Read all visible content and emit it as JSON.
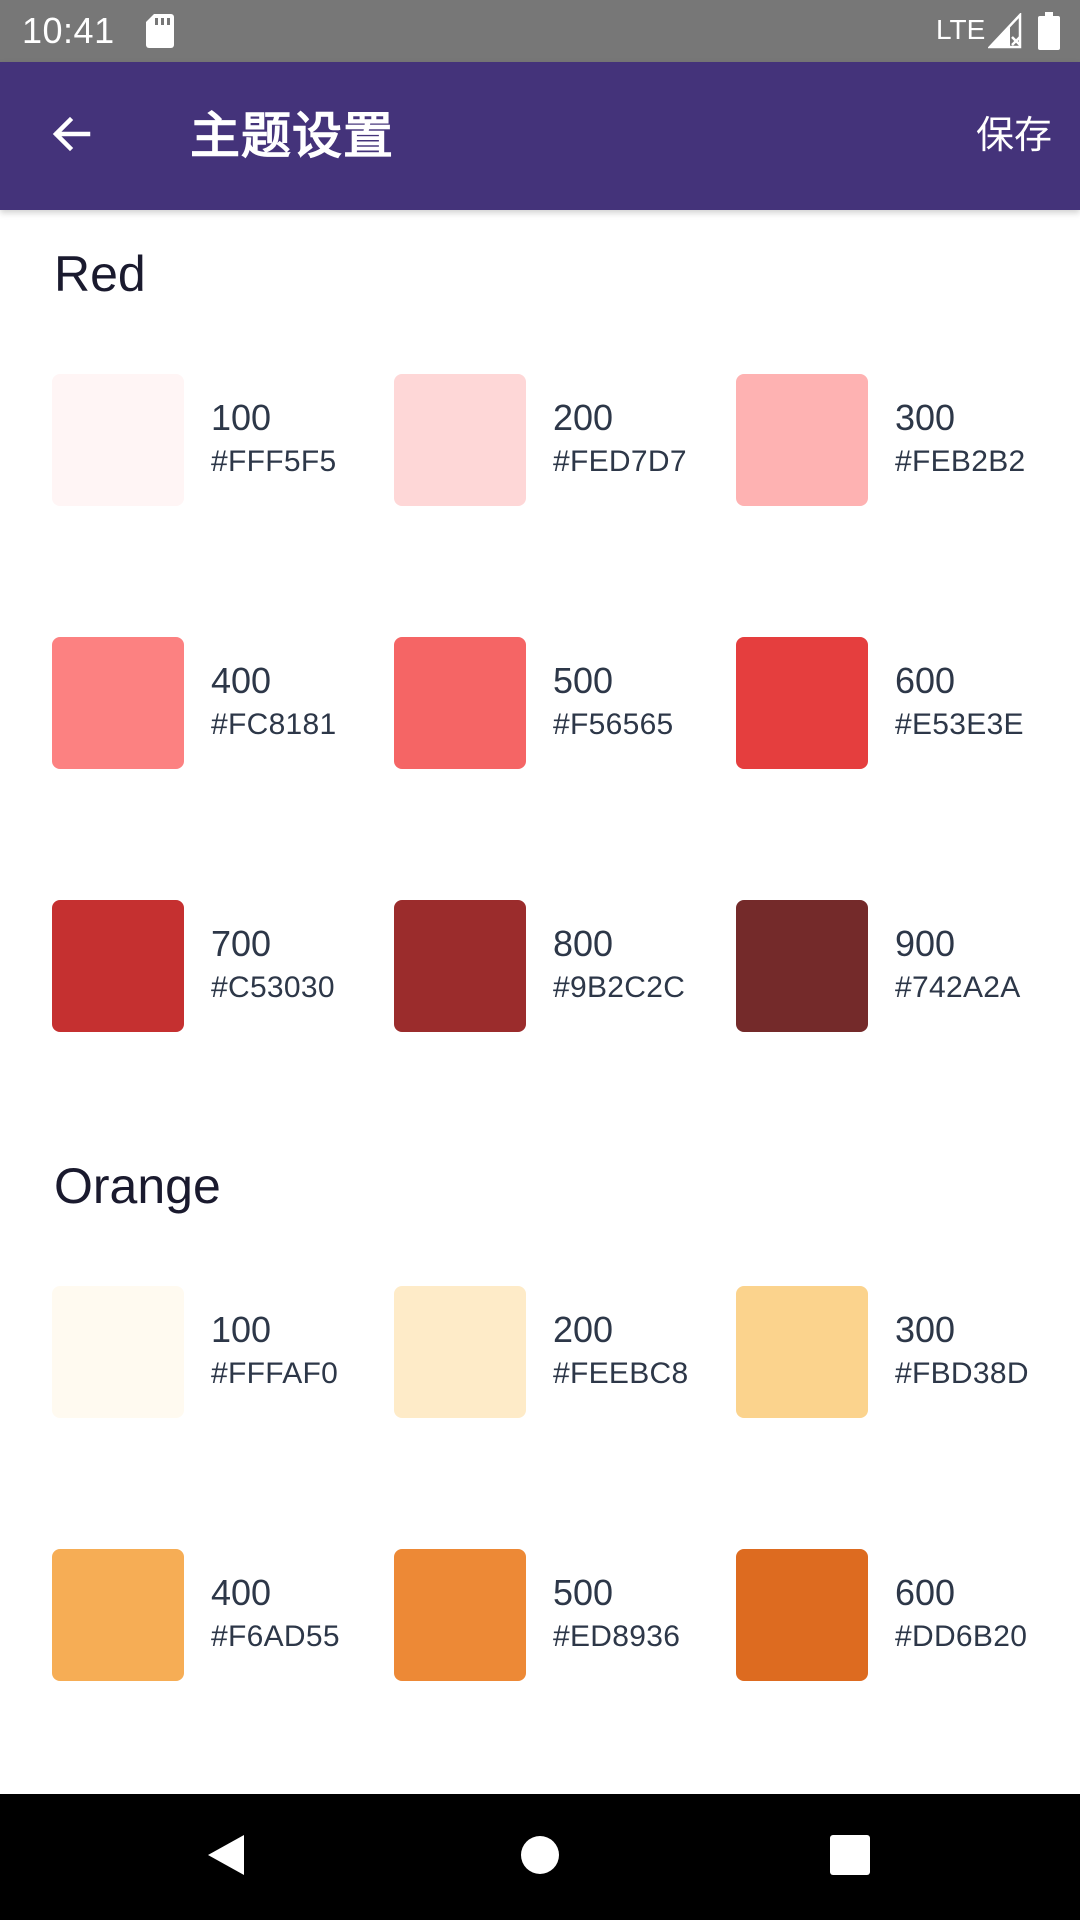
{
  "status_bar": {
    "time": "10:41",
    "network": "LTE",
    "icons": [
      "sd-card-icon",
      "signal-icon",
      "battery-icon"
    ]
  },
  "app_bar": {
    "title": "主题设置",
    "save_label": "保存",
    "background": "#44337A",
    "back_icon": "arrow-left-icon"
  },
  "sections": [
    {
      "title": "Red",
      "swatches": [
        {
          "shade": "100",
          "hex": "#FFF5F5"
        },
        {
          "shade": "200",
          "hex": "#FED7D7"
        },
        {
          "shade": "300",
          "hex": "#FEB2B2"
        },
        {
          "shade": "400",
          "hex": "#FC8181"
        },
        {
          "shade": "500",
          "hex": "#F56565"
        },
        {
          "shade": "600",
          "hex": "#E53E3E"
        },
        {
          "shade": "700",
          "hex": "#C53030"
        },
        {
          "shade": "800",
          "hex": "#9B2C2C"
        },
        {
          "shade": "900",
          "hex": "#742A2A"
        }
      ]
    },
    {
      "title": "Orange",
      "swatches": [
        {
          "shade": "100",
          "hex": "#FFFAF0"
        },
        {
          "shade": "200",
          "hex": "#FEEBC8"
        },
        {
          "shade": "300",
          "hex": "#FBD38D"
        },
        {
          "shade": "400",
          "hex": "#F6AD55"
        },
        {
          "shade": "500",
          "hex": "#ED8936"
        },
        {
          "shade": "600",
          "hex": "#DD6B20"
        }
      ]
    }
  ],
  "nav_bar": {
    "icons": [
      "nav-back-icon",
      "nav-home-icon",
      "nav-recents-icon"
    ]
  }
}
